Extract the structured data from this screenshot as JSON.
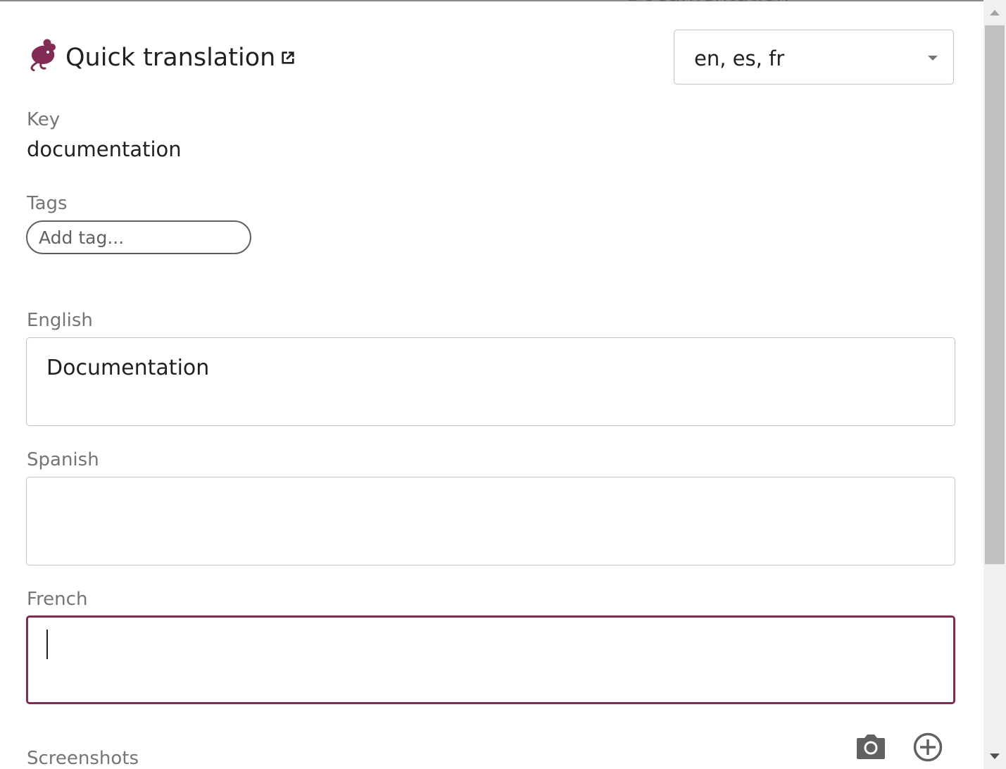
{
  "header": {
    "title": "Quick translation",
    "logo_icon": "mouse-logo-icon",
    "open_icon": "open-in-new-icon",
    "brand_color": "#822b55"
  },
  "language_select": {
    "value": "en, es, fr",
    "icon": "caret-down-icon"
  },
  "peek_text": "Documentation",
  "key": {
    "label": "Key",
    "value": "documentation"
  },
  "tags": {
    "label": "Tags",
    "placeholder": "Add tag..."
  },
  "translations": [
    {
      "label": "English",
      "value": "Documentation",
      "focused": false
    },
    {
      "label": "Spanish",
      "value": "",
      "focused": false
    },
    {
      "label": "French",
      "value": "",
      "focused": true
    }
  ],
  "screenshots": {
    "label": "Screenshots",
    "camera_icon": "camera-icon",
    "add_icon": "add-circle-icon"
  },
  "focus_color": "#822b55"
}
